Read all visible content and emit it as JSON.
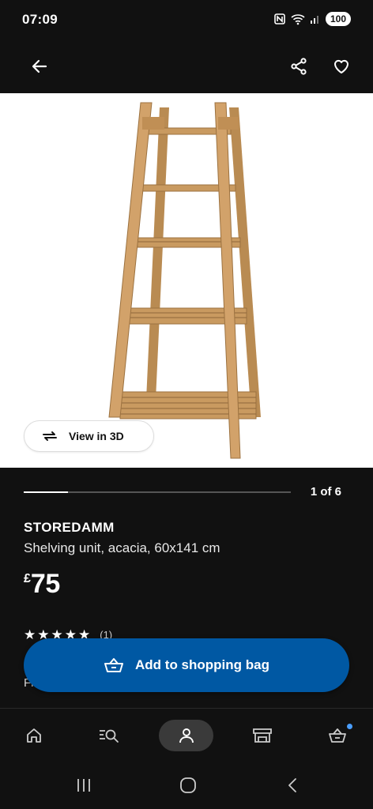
{
  "status_bar": {
    "time": "07:09",
    "battery": "100",
    "icons": [
      "nfc-icon",
      "wifi-icon",
      "signal-icon",
      "battery-icon"
    ]
  },
  "top_bar": {
    "icons": [
      "back-arrow-icon",
      "share-icon",
      "heart-icon"
    ]
  },
  "gallery": {
    "view_3d_label": "View in 3D",
    "pager_label": "1 of 6",
    "pager_progress": 0.167
  },
  "product": {
    "brand": "STOREDAMM",
    "description": "Shelving unit, acacia, 60x141 cm",
    "currency": "£",
    "price": "75",
    "rating_stars": 5,
    "rating_count": "(1)",
    "partial_text": "Fi"
  },
  "cta": {
    "label": "Add to shopping bag",
    "color": "#0058a3"
  },
  "bottom_nav": {
    "items": [
      "home-icon",
      "search-list-icon",
      "profile-icon",
      "store-icon",
      "basket-icon"
    ],
    "active": "profile-icon",
    "accent": "#4a9eff"
  },
  "system_nav": {
    "items": [
      "recents-icon",
      "home-circle-icon",
      "back-chevron-icon"
    ]
  }
}
